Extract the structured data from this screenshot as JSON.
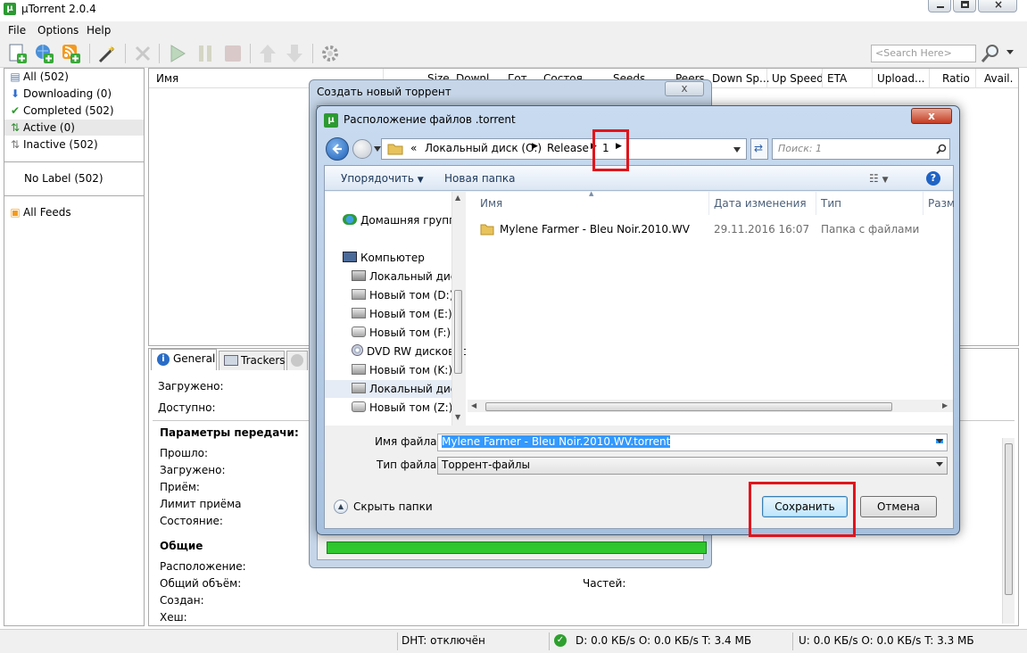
{
  "app": {
    "title": "µTorrent 2.0.4",
    "logo": "µ"
  },
  "menu": [
    "File",
    "Options",
    "Help"
  ],
  "search": {
    "placeholder": "<Search Here>"
  },
  "sidebar": {
    "items": [
      {
        "label": "All (502)",
        "icon": "all-icon"
      },
      {
        "label": "Downloading (0)",
        "icon": "download-arrow-icon"
      },
      {
        "label": "Completed (502)",
        "icon": "checkmark-icon"
      },
      {
        "label": "Active (0)",
        "icon": "active-arrows-icon"
      },
      {
        "label": "Inactive (502)",
        "icon": "inactive-arrows-icon"
      }
    ],
    "no_label": "No Label (502)",
    "feeds": "All Feeds"
  },
  "columns": [
    "Имя",
    "Size",
    "Downl...",
    "Гот...",
    "Состоя...",
    "Seeds",
    "Peers",
    "Down Sp...",
    "Up Speed",
    "ETA",
    "Upload...",
    "Ratio",
    "Avail."
  ],
  "detail": {
    "tabs": [
      "General",
      "Trackers"
    ],
    "downloaded_label": "Загружено:",
    "available_label": "Доступно:",
    "transfer_header": "Параметры передачи:",
    "transfer_rows": [
      "Прошло:",
      "Загружено:",
      "Приём:",
      "Лимит приёма",
      "Состояние:"
    ],
    "general_header": "Общие",
    "general_rows": [
      "Расположение:",
      "Общий объём:",
      "Создан:",
      "Хеш:"
    ],
    "pieces_label": "Частей:"
  },
  "status": {
    "dht": "DHT: отключён",
    "down": "D: 0.0 КБ/s O: 0.0 КБ/s T: 3.4 МБ",
    "up": "U: 0.0 КБ/s O: 0.0 КБ/s T: 3.3 МБ"
  },
  "create_dialog": {
    "title": "Создать новый торрент",
    "progress": 1.0
  },
  "save_dialog": {
    "title": "Расположение файлов .torrent",
    "logo": "µ",
    "close": "x",
    "breadcrumb": {
      "prefix": "«",
      "items": [
        "Локальный диск (O:)",
        "Release",
        "1"
      ]
    },
    "search_placeholder": "Поиск: 1",
    "toolbar": {
      "organize": "Упорядочить",
      "new_folder": "Новая папка"
    },
    "nav": [
      {
        "label": "Домашняя группа",
        "icon": "homegroup-icon"
      },
      {
        "label": "Компьютер",
        "icon": "computer-icon"
      },
      {
        "label": "Локальный диск",
        "icon": "local-disk-icon"
      },
      {
        "label": "Новый том (D:)",
        "icon": "drive-icon"
      },
      {
        "label": "Новый том (E:)",
        "icon": "drive-icon"
      },
      {
        "label": "Новый том (F:)",
        "icon": "drive-icon"
      },
      {
        "label": "DVD RW дисковод",
        "icon": "dvd-icon"
      },
      {
        "label": "Новый том (K:)",
        "icon": "drive-icon"
      },
      {
        "label": "Локальный диск",
        "icon": "drive-icon"
      },
      {
        "label": "Новый том (Z:)",
        "icon": "drive-icon"
      }
    ],
    "file_columns": [
      "Имя",
      "Дата изменения",
      "Тип",
      "Разм"
    ],
    "files": [
      {
        "name": "Mylene Farmer - Bleu Noir.2010.WV",
        "date": "29.11.2016 16:07",
        "type": "Папка с файлами"
      }
    ],
    "filename_label": "Имя файла:",
    "filename_value": "Mylene Farmer - Bleu Noir.2010.WV.torrent",
    "filetype_label": "Тип файла:",
    "filetype_value": "Торрент-файлы",
    "hide_folders": "Скрыть папки",
    "save": "Сохранить",
    "cancel": "Отмена"
  }
}
